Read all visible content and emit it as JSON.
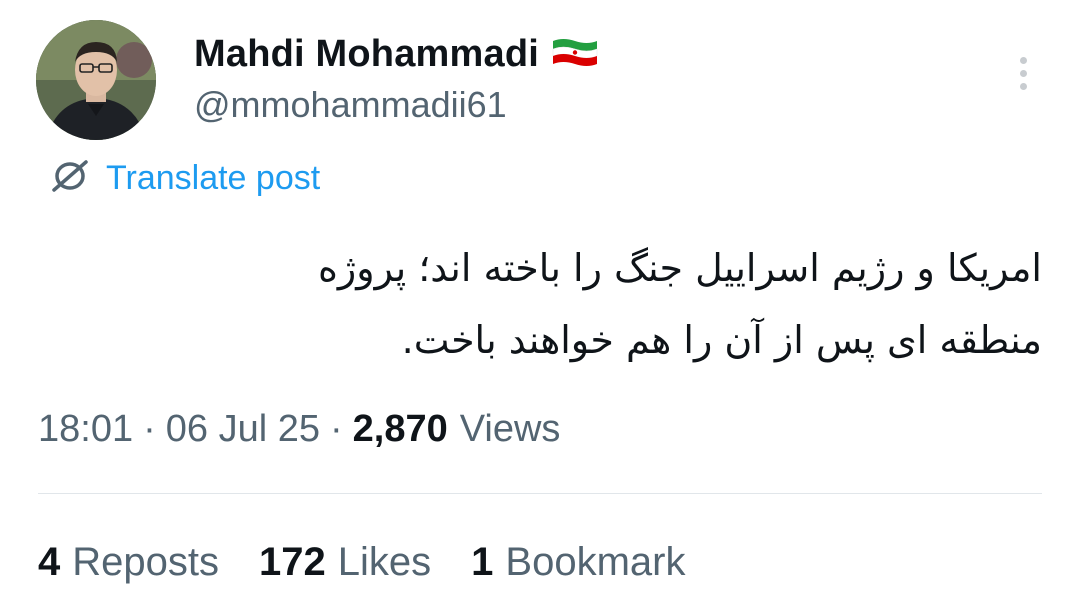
{
  "author": {
    "display_name": "Mahdi Mohammadi",
    "handle": "@mmohammadii61",
    "flag_icon": "iran-flag-icon",
    "flag_colors": [
      "#239f40",
      "#ffffff",
      "#da0000"
    ]
  },
  "translate": {
    "label": "Translate post",
    "icon": "globe-slash-icon",
    "color": "#1d9bf0"
  },
  "post": {
    "lines": [
      "امریکا و رژیم اسراییل جنگ را باخته اند؛ پروژه",
      "منطقه ای پس از آن را هم خواهند باخت."
    ]
  },
  "meta": {
    "time": "18:01",
    "date": "06 Jul 25",
    "views_count": "2,870",
    "views_label": "Views"
  },
  "stats": {
    "reposts_count": "4",
    "reposts_label": "Reposts",
    "likes_count": "172",
    "likes_label": "Likes",
    "bookmarks_count": "1",
    "bookmarks_label": "Bookmark"
  },
  "more_icon": "more-vertical-icon"
}
